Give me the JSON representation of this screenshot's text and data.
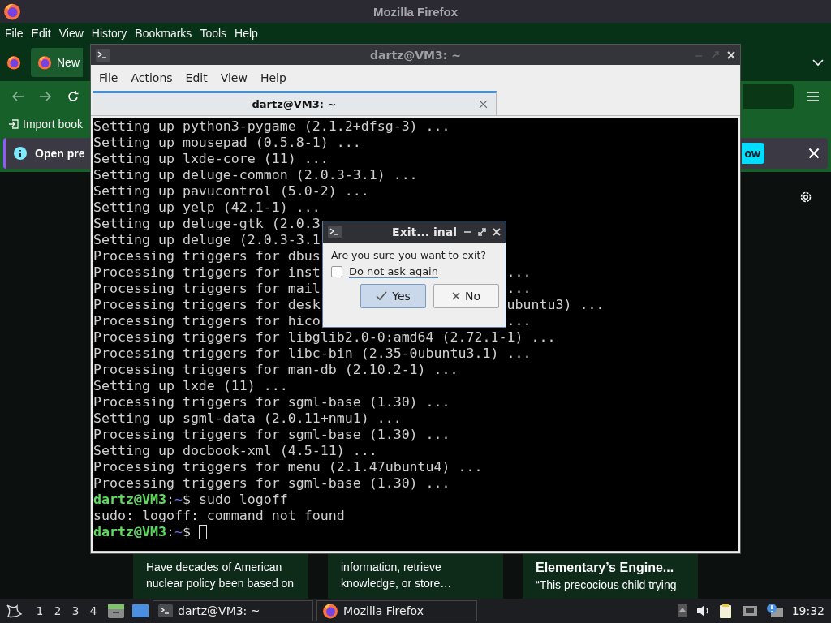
{
  "firefox": {
    "title": "Mozilla Firefox",
    "menu": [
      "File",
      "Edit",
      "View",
      "History",
      "Bookmarks",
      "Tools",
      "Help"
    ],
    "tab": {
      "label": "New"
    },
    "bookmark": "Import book",
    "notification": {
      "text": "Open pre",
      "button": "ow"
    },
    "cards": [
      {
        "lines": [
          "Have decades of American",
          "nuclear policy been based on"
        ]
      },
      {
        "lines": [
          "information, retrieve",
          "knowledge, or store…"
        ]
      },
      {
        "title": "Elementary’s Engine...",
        "lines": [
          "“This precocious child trying"
        ]
      }
    ]
  },
  "terminal": {
    "title": "dartz@VM3: ~",
    "menu": [
      "File",
      "Actions",
      "Edit",
      "View",
      "Help"
    ],
    "tab": {
      "label": "dartz@VM3: ~",
      "selected": true
    },
    "lines": [
      {
        "kind": "output",
        "text": "Setting up python3-pygame (2.1.2+dfsg-3) ..."
      },
      {
        "kind": "output",
        "text": "Setting up mousepad (0.5.8-1) ..."
      },
      {
        "kind": "output",
        "text": "Setting up lxde-core (11) ..."
      },
      {
        "kind": "output",
        "text": "Setting up deluge-common (2.0.3-3.1) ..."
      },
      {
        "kind": "output",
        "text": "Setting up pavucontrol (5.0-2) ..."
      },
      {
        "kind": "output",
        "text": "Setting up yelp (42.1-1) ..."
      },
      {
        "kind": "output",
        "text": "Setting up deluge-gtk (2.0.3"
      },
      {
        "kind": "output",
        "text": "Setting up deluge (2.0.3-3.1"
      },
      {
        "kind": "output",
        "text": "Processing triggers for dbus"
      },
      {
        "kind": "output",
        "text": "Processing triggers for inst",
        "right": "..."
      },
      {
        "kind": "output",
        "text": "Processing triggers for mail",
        "right": "..."
      },
      {
        "kind": "output",
        "text": "Processing triggers for desk",
        "right": "ubuntu3) ..."
      },
      {
        "kind": "output",
        "text": "Processing triggers for hico",
        "right": "..."
      },
      {
        "kind": "output",
        "text": "Processing triggers for libglib2.0-0:amd64 (2.72.1-1) ..."
      },
      {
        "kind": "output",
        "text": "Processing triggers for libc-bin (2.35-0ubuntu3.1) ..."
      },
      {
        "kind": "output",
        "text": "Processing triggers for man-db (2.10.2-1) ..."
      },
      {
        "kind": "output",
        "text": "Setting up lxde (11) ..."
      },
      {
        "kind": "output",
        "text": "Processing triggers for sgml-base (1.30) ..."
      },
      {
        "kind": "output",
        "text": "Setting up sgml-data (2.0.11+nmu1) ..."
      },
      {
        "kind": "output",
        "text": "Processing triggers for sgml-base (1.30) ..."
      },
      {
        "kind": "output",
        "text": "Setting up docbook-xml (4.5-11) ..."
      },
      {
        "kind": "output",
        "text": "Processing triggers for menu (2.1.47ubuntu4) ..."
      },
      {
        "kind": "output",
        "text": "Processing triggers for sgml-base (1.30) ..."
      },
      {
        "kind": "prompt",
        "user": "dartz@VM3",
        "sep": ":",
        "path": "~",
        "symbol": "$",
        "command": "sudo logoff"
      },
      {
        "kind": "output",
        "text": "sudo: logoff: command not found"
      },
      {
        "kind": "prompt",
        "user": "dartz@VM3",
        "sep": ":",
        "path": "~",
        "symbol": "$",
        "cursor": true
      }
    ]
  },
  "dialog": {
    "title": "Exit... inal",
    "message": "Are you sure you want to exit?",
    "checkbox": {
      "label": "Do not ask again",
      "checked": false
    },
    "buttons": [
      {
        "label": "Yes",
        "kind": "confirm",
        "selected": true
      },
      {
        "label": "No",
        "kind": "cancel",
        "selected": false
      }
    ]
  },
  "taskbar": {
    "workspaces": [
      "1",
      "2",
      "3",
      "4"
    ],
    "tasks": [
      {
        "label": "dartz@VM3: ~",
        "kind": "terminal"
      },
      {
        "label": "Mozilla Firefox",
        "kind": "browser"
      }
    ],
    "clock": "19:32"
  }
}
